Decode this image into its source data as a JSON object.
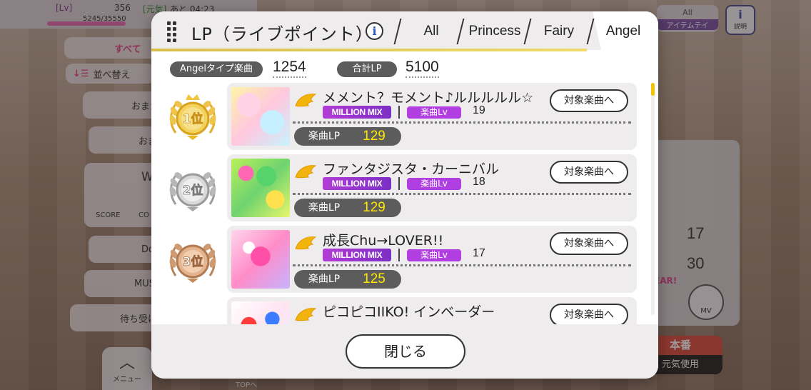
{
  "background": {
    "lv_label": "[Lv]",
    "lv_value": "356",
    "exp": "5245/35550",
    "genki_label": "[元気]",
    "genki_time": "あと 04:23",
    "sort_all": "すべて",
    "sort_order": "並べ替え",
    "list_items": [
      "おまか",
      "おま",
      "W",
      "Do",
      "MUS",
      "待ち受け"
    ],
    "score_label": "SCORE",
    "co_label": "CO",
    "right_num_1": "17",
    "right_num_2": "30",
    "honban": "本番",
    "honban_sub": "元気使用",
    "item_btn_top": "All",
    "item_btn_sub": "アイテムテイ",
    "help_btn": "説明",
    "menu_btn": "メニュー",
    "top_link": "TOPへ",
    "mv_label": "MV",
    "clear_label": "EAR!"
  },
  "modal": {
    "title": "LP（ライブポイント）",
    "tabs": [
      "All",
      "Princess",
      "Fairy",
      "Angel"
    ],
    "active_tab": "Angel",
    "summary": {
      "type_label": "Angelタイプ楽曲",
      "type_count": "1254",
      "total_label": "合計LP",
      "total_value": "5100"
    },
    "songs": [
      {
        "rank_text": "1位",
        "title": "メメント？モメント♪ルルルルル☆",
        "badge": "MILLION MIX",
        "lv_label": "楽曲Lv",
        "lv": "19",
        "lp_label": "楽曲LP",
        "lp": "129",
        "button": "対象楽曲へ"
      },
      {
        "rank_text": "2位",
        "title": "ファンタジスタ・カーニバル",
        "badge": "MILLION MIX",
        "lv_label": "楽曲Lv",
        "lv": "18",
        "lp_label": "楽曲LP",
        "lp": "129",
        "button": "対象楽曲へ"
      },
      {
        "rank_text": "3位",
        "title": "成長Chu→LOVER!!",
        "badge": "MILLION MIX",
        "lv_label": "楽曲Lv",
        "lv": "17",
        "lp_label": "楽曲LP",
        "lp": "125",
        "button": "対象楽曲へ"
      },
      {
        "rank_text": "",
        "title": "ピコピコIIKO! インベーダー",
        "badge": "",
        "lv_label": "",
        "lv": "",
        "lp_label": "",
        "lp": "",
        "button": "対象楽曲へ"
      }
    ],
    "close": "閉じる"
  },
  "colors": {
    "gold": "#e8b923",
    "silver": "#a8a8a8",
    "bronze": "#c08a5e",
    "million_mix": "#b23cd6",
    "lp_value": "#ffe600",
    "header_underline": "#e0c85a"
  },
  "icons": [
    "grip-icon",
    "info-icon",
    "wing-icon",
    "medal-icon",
    "up-chevron-icon"
  ]
}
